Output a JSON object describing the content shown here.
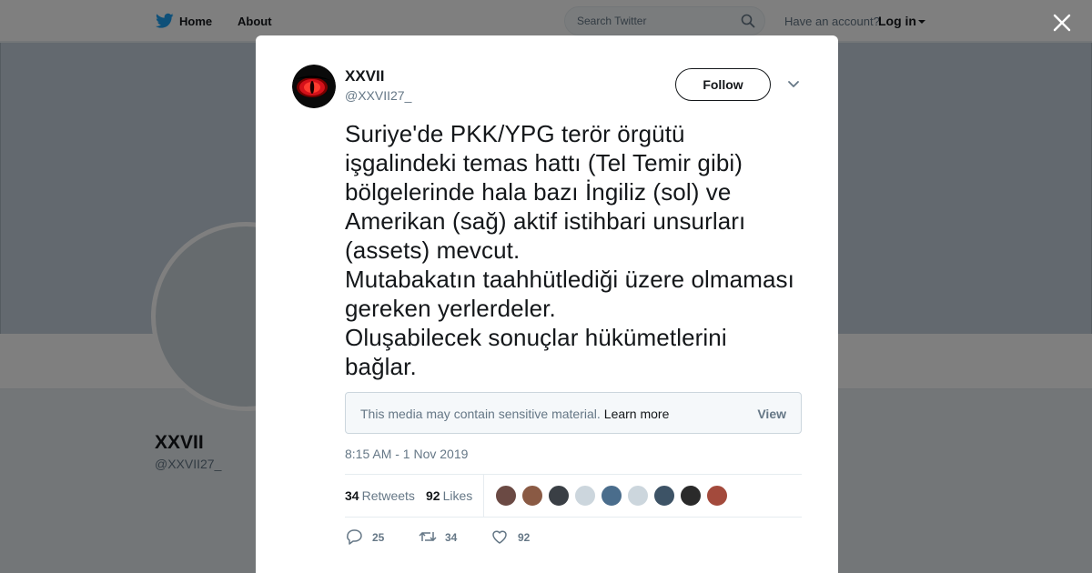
{
  "topbar": {
    "home_label": "Home",
    "about_label": "About",
    "search_placeholder": "Search Twitter",
    "have_account": "Have an account?",
    "login_label": "Log in"
  },
  "profile": {
    "name": "XXVII",
    "handle": "@XXVII27_"
  },
  "tweet": {
    "author_name": "XXVII",
    "author_handle": "@XXVII27_",
    "follow_label": "Follow",
    "text": "Suriye'de PKK/YPG terör örgütü işgalindeki temas hattı (Tel Temir gibi) bölgelerinde hala bazı İngiliz (sol) ve Amerikan (sağ) aktif istihbari unsurları (assets) mevcut.\nMutabakatın taahhütlediği üzere olmaması gereken yerlerdeler.\nOluşabilecek sonuçlar hükümetlerini bağlar.",
    "sensitive_message": "This media may contain sensitive material.",
    "learn_more": "Learn more",
    "view_label": "View",
    "timestamp": "8:15 AM - 1 Nov 2019",
    "retweets_count": "34",
    "retweets_label": "Retweets",
    "likes_count": "92",
    "likes_label": "Likes",
    "reply_count": "25",
    "retweet_action_count": "34",
    "like_action_count": "92"
  },
  "likers": [
    {
      "color": "#6b4a44"
    },
    {
      "color": "#8a5a44"
    },
    {
      "color": "#3a3f45"
    },
    {
      "color": "#ccd6dd"
    },
    {
      "color": "#4a6d8c"
    },
    {
      "color": "#ccd6dd"
    },
    {
      "color": "#3d5366"
    },
    {
      "color": "#2a2a2a"
    },
    {
      "color": "#a34a3c"
    }
  ],
  "icons": {
    "bird": "twitter-bird-icon",
    "search": "search-icon",
    "close": "close-icon",
    "caret": "chevron-down-icon",
    "reply": "reply-icon",
    "retweet": "retweet-icon",
    "like": "heart-icon"
  },
  "colors": {
    "brand_blue": "#1da1f2",
    "text_primary": "#14171a",
    "text_secondary": "#657786"
  }
}
